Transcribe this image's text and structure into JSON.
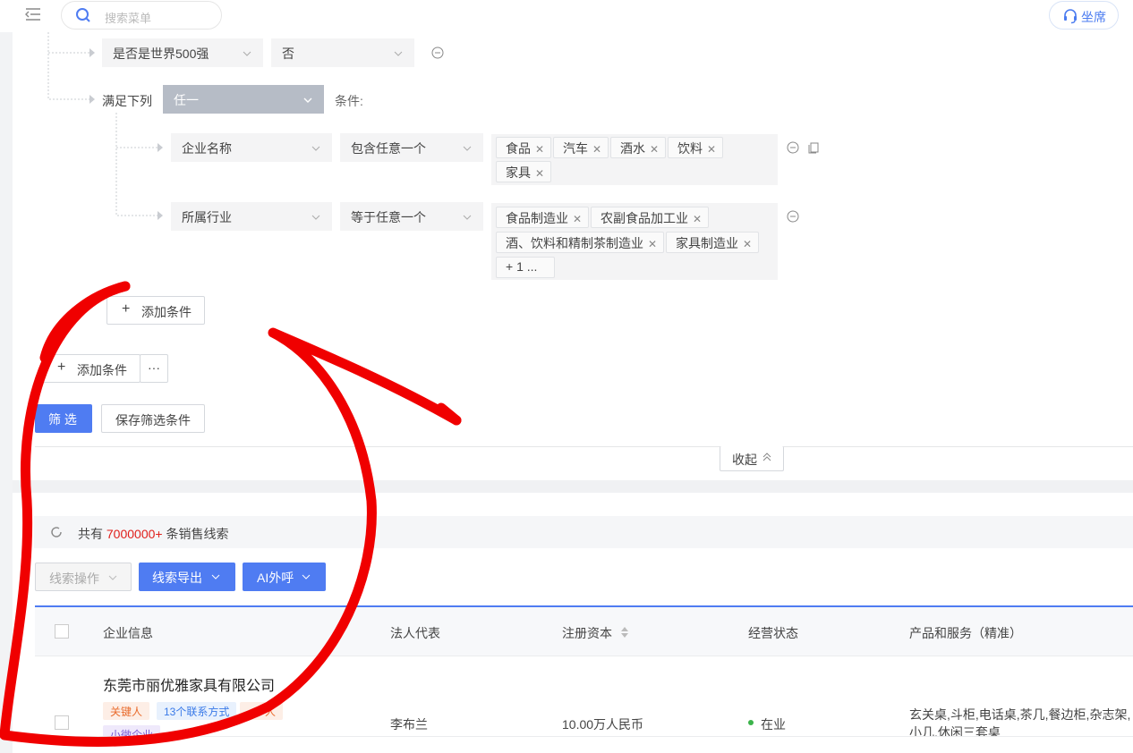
{
  "header": {
    "search_placeholder": "搜索菜单",
    "seat_label": "坐席"
  },
  "filters": {
    "row1": {
      "field": "是否是世界500强",
      "value": "否"
    },
    "group": {
      "prefix": "满足下列",
      "mode": "任一",
      "suffix": "条件:",
      "conditions": [
        {
          "field": "企业名称",
          "operator": "包含任意一个",
          "tags": [
            "食品",
            "汽车",
            "酒水",
            "饮料",
            "家具"
          ]
        },
        {
          "field": "所属行业",
          "operator": "等于任意一个",
          "tags": [
            "食品制造业",
            "农副食品加工业",
            "酒、饮料和精制茶制造业",
            "家具制造业"
          ],
          "more": "+ 1 ..."
        }
      ],
      "add_label": "添加条件"
    },
    "add_condition": "添加条件",
    "more_label": "···",
    "filter_button": "筛 选",
    "save_button": "保存筛选条件",
    "collapse_label": "收起"
  },
  "results": {
    "count_prefix": "共有",
    "count_value": "7000000+",
    "count_suffix": "条销售线索",
    "actions": [
      "线索操作",
      "线索导出",
      "AI外呼"
    ],
    "columns": [
      "企业信息",
      "法人代表",
      "注册资本",
      "经营状态",
      "产品和服务（精准）"
    ],
    "rows": [
      {
        "company": "东莞市丽优雅家具有限公司",
        "tags": [
          "关键人",
          "13个联系方式",
          "人",
          "小微企业"
        ],
        "legal_rep": "李布兰",
        "capital": "10.00万人民币",
        "status": "在业",
        "products": "玄关桌,斗柜,电话桌,茶几,餐边柜,杂志架,小几,休闲三套桌"
      }
    ]
  },
  "colors": {
    "accent": "#4f7cf2",
    "highlight": "#e0201c",
    "annotation": "#f00000"
  }
}
